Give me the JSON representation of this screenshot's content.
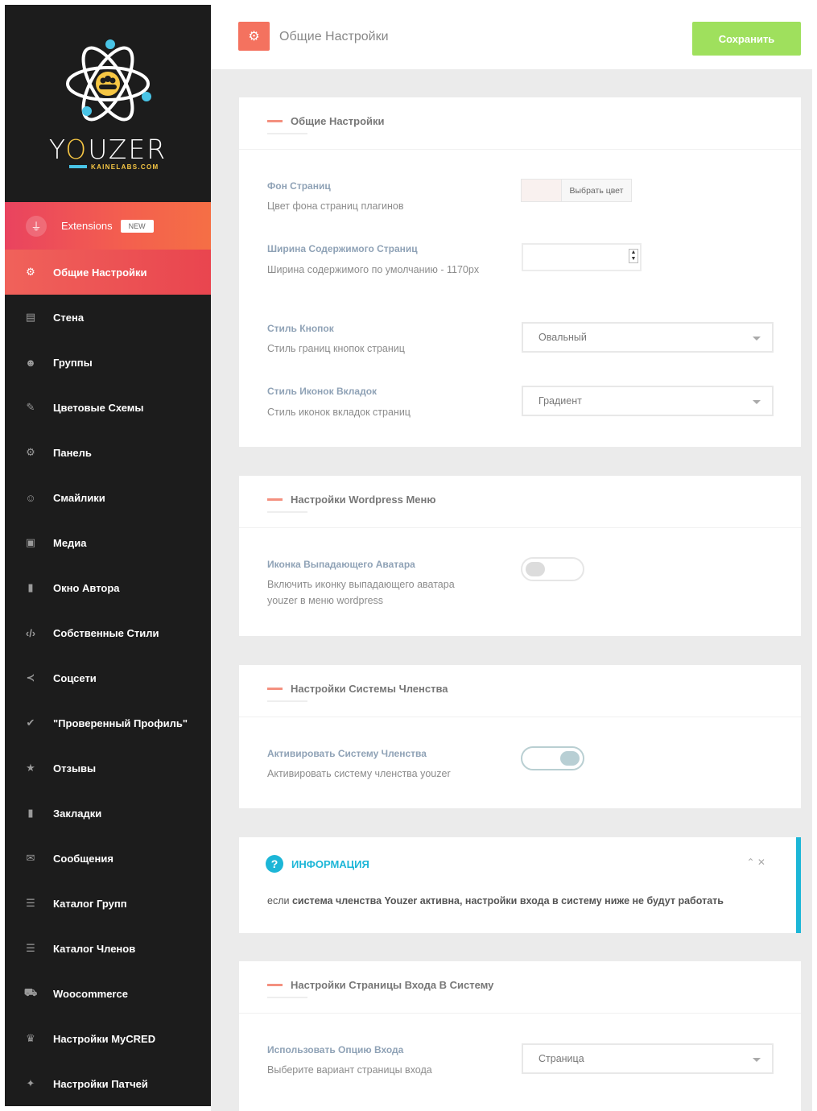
{
  "brand": {
    "name_pre": "Y",
    "name_o": "O",
    "name_post": "UZER",
    "sub": "KAINELABS.COM"
  },
  "sidebar": {
    "extensions": {
      "label": "Extensions",
      "badge": "NEW"
    },
    "items": [
      {
        "label": "Общие Настройки",
        "icon": "gears-icon",
        "glyph": "⚙"
      },
      {
        "label": "Стена",
        "icon": "id-card-icon",
        "glyph": "▤"
      },
      {
        "label": "Группы",
        "icon": "users-icon",
        "glyph": "☻"
      },
      {
        "label": "Цветовые Схемы",
        "icon": "brush-icon",
        "glyph": "✎"
      },
      {
        "label": "Панель",
        "icon": "cogs-icon",
        "glyph": "⚙"
      },
      {
        "label": "Смайлики",
        "icon": "smile-icon",
        "glyph": "☺"
      },
      {
        "label": "Медиа",
        "icon": "images-icon",
        "glyph": "▣"
      },
      {
        "label": "Окно Автора",
        "icon": "address-book-icon",
        "glyph": "▮"
      },
      {
        "label": "Собственные Стили",
        "icon": "code-icon",
        "glyph": "‹/›"
      },
      {
        "label": "Соцсети",
        "icon": "share-icon",
        "glyph": "≺"
      },
      {
        "label": "\"Проверенный Профиль\"",
        "icon": "check-circle-icon",
        "glyph": "✔"
      },
      {
        "label": "Отзывы",
        "icon": "star-icon",
        "glyph": "★"
      },
      {
        "label": "Закладки",
        "icon": "bookmark-icon",
        "glyph": "▮"
      },
      {
        "label": "Сообщения",
        "icon": "envelope-icon",
        "glyph": "✉"
      },
      {
        "label": "Каталог Групп",
        "icon": "list-alt-icon",
        "glyph": "☰"
      },
      {
        "label": "Каталог Членов",
        "icon": "list-icon",
        "glyph": "☰"
      },
      {
        "label": "Woocommerce",
        "icon": "cart-icon",
        "glyph": "⛟"
      },
      {
        "label": "Настройки MyCRED",
        "icon": "trophy-icon",
        "glyph": "♛"
      },
      {
        "label": "Настройки Патчей",
        "icon": "magic-icon",
        "glyph": "✦"
      }
    ]
  },
  "header": {
    "title": "Общие Настройки",
    "save_label": "Сохранить"
  },
  "sections": {
    "general": {
      "title": "Общие Настройки",
      "bg": {
        "label": "Фон Страниц",
        "desc": "Цвет фона страниц плагинов",
        "button": "Выбрать цвет",
        "color": "#f9f1ef"
      },
      "width": {
        "label": "Ширина Содержимого Страниц",
        "desc": "Ширина содержимого по умолчанию - 1170px",
        "value": ""
      },
      "buttons": {
        "label": "Стиль Кнопок",
        "desc": "Стиль границ кнопок страниц",
        "value": "Овальный"
      },
      "tabs": {
        "label": "Стиль Иконок Вкладок",
        "desc": "Стиль иконок вкладок страниц",
        "value": "Градиент"
      }
    },
    "wpmenu": {
      "title": "Настройки Wordpress Меню",
      "avatar": {
        "label": "Иконка Выпадающего Аватара",
        "desc": "Включить иконку выпадающего аватара youzer в меню wordpress",
        "enabled": false
      }
    },
    "membership": {
      "title": "Настройки Системы Членства",
      "activate": {
        "label": "Активировать Систему Членства",
        "desc": "Активировать систему членства youzer",
        "enabled": true
      }
    },
    "info": {
      "title": "ИНФОРМАЦИЯ",
      "text_pre": "если",
      "text_main": "система членства Youzer активна, настройки входа в систему ниже не будут работать",
      "controls": "⌃  ✕"
    },
    "login": {
      "title": "Настройки Страницы Входа В Систему",
      "option": {
        "label": "Использовать Опцию Входа",
        "desc": "Выберите вариант страницы входа",
        "value": "Страница"
      }
    }
  },
  "colors": {
    "accent": "#f0625a",
    "save": "#9fe05d",
    "info": "#1cb6d7",
    "sidebar_bg": "#1c1c1c"
  }
}
